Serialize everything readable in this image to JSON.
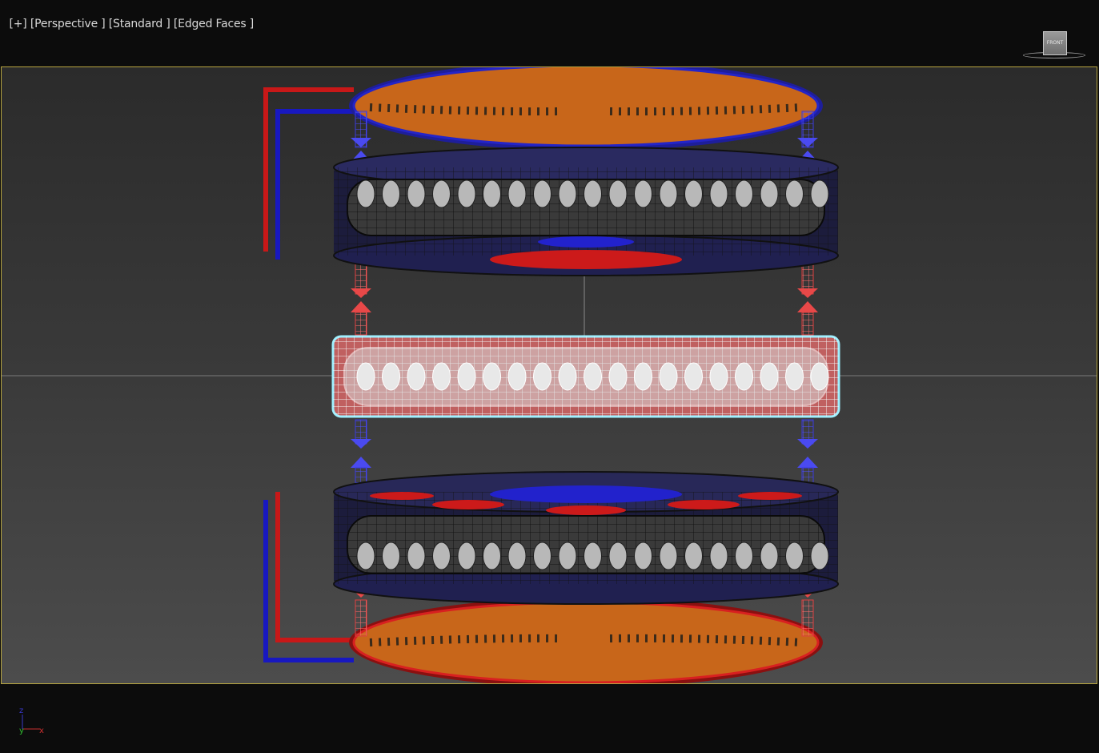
{
  "viewport_label": {
    "plus": "[+]",
    "view": "[Perspective ]",
    "shading": "[Standard ]",
    "edges": "[Edged Faces ]"
  },
  "viewcube": {
    "face_label": "FRONT"
  },
  "axis_tripod": {
    "z": "z",
    "y": "y",
    "x": "x"
  },
  "colors": {
    "viewport_border": "#b8a640",
    "background_top": "#2b2b2b",
    "background_bottom": "#4c4c4c",
    "orange_plate": "#c8661a",
    "blue": "#2a2ad0",
    "red": "#d02020",
    "selection": "#7fe8ff"
  },
  "icons": [
    "viewcube-icon",
    "axis-tripod-icon"
  ]
}
